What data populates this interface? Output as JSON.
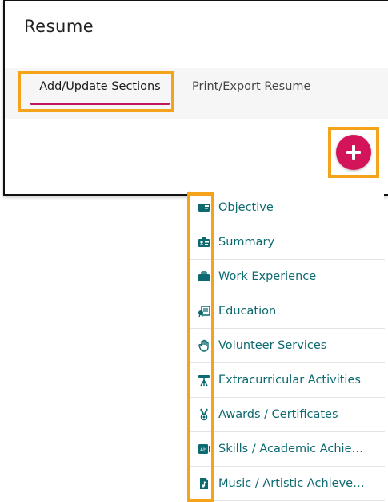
{
  "header": {
    "title": "Resume"
  },
  "tabs": [
    {
      "label": "Add/Update Sections",
      "active": true
    },
    {
      "label": "Print/Export Resume",
      "active": false
    }
  ],
  "fab": {
    "icon": "plus-icon",
    "color": "#d3145a"
  },
  "colors": {
    "accent": "#c2185b",
    "menu_text": "#0c6a70",
    "highlight": "#f5a31a"
  },
  "menu": {
    "items": [
      {
        "label": "Objective",
        "icon": "id-card-icon"
      },
      {
        "label": "Summary",
        "icon": "badge-icon"
      },
      {
        "label": "Work Experience",
        "icon": "briefcase-icon"
      },
      {
        "label": "Education",
        "icon": "diploma-icon"
      },
      {
        "label": "Volunteer Services",
        "icon": "raised-hand-icon"
      },
      {
        "label": "Extracurricular Activities",
        "icon": "telescope-icon"
      },
      {
        "label": "Awards / Certificates",
        "icon": "medal-icon"
      },
      {
        "label": "Skills / Academic Achie…",
        "icon": "skills-icon"
      },
      {
        "label": "Music / Artistic Achieve…",
        "icon": "music-file-icon"
      }
    ]
  }
}
